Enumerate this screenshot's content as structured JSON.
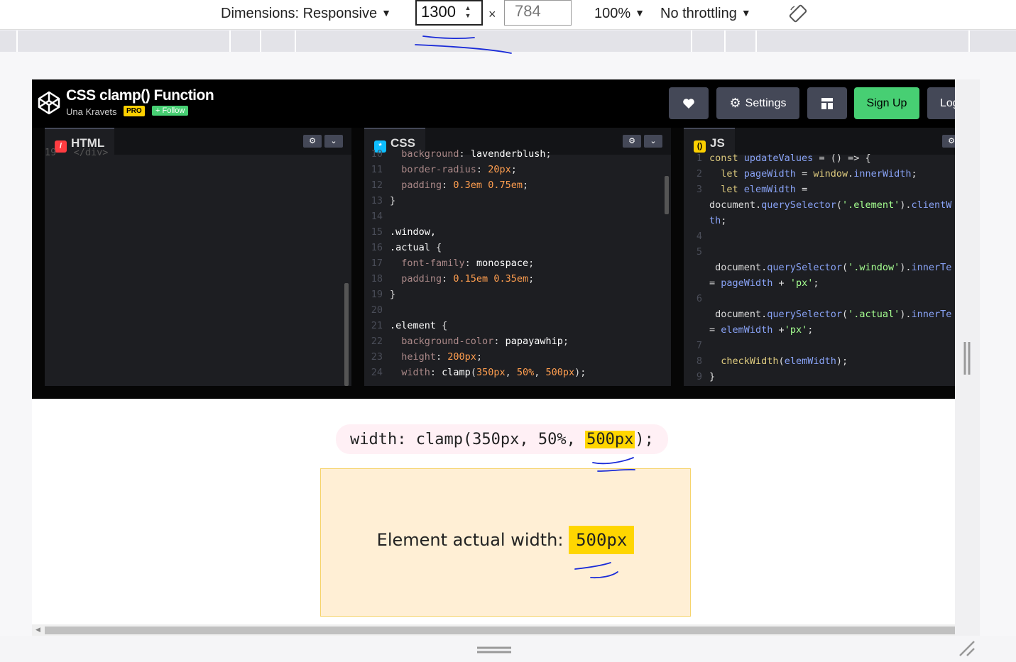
{
  "toolbar": {
    "dimensions_label": "Dimensions: Responsive",
    "width_value": "1300",
    "times": "×",
    "height_placeholder": "784",
    "zoom": "100%",
    "throttling": "No throttling"
  },
  "codepen": {
    "title": "CSS clamp() Function",
    "author": "Una Kravets",
    "pro_badge": "PRO",
    "follow": "+ Follow",
    "settings_label": "Settings",
    "signup_label": "Sign Up",
    "login_label": "Log In",
    "brand_green": "#47cf73"
  },
  "panels": {
    "html": {
      "label": "HTML",
      "visible_fragment": "19   </div>"
    },
    "css": {
      "label": "CSS",
      "lines": [
        {
          "n": "10",
          "parts": [
            [
              "p",
              "  background"
            ],
            [
              "x",
              ": "
            ],
            [
              "v",
              "lavenderblush"
            ],
            [
              "x",
              ";"
            ]
          ]
        },
        {
          "n": "11",
          "parts": [
            [
              "p",
              "  border-radius"
            ],
            [
              "x",
              ": "
            ],
            [
              "u",
              "20px"
            ],
            [
              "x",
              ";"
            ]
          ]
        },
        {
          "n": "12",
          "parts": [
            [
              "p",
              "  padding"
            ],
            [
              "x",
              ": "
            ],
            [
              "u",
              "0.3em 0.75em"
            ],
            [
              "x",
              ";"
            ]
          ]
        },
        {
          "n": "13",
          "parts": [
            [
              "x",
              "}"
            ]
          ]
        },
        {
          "n": "14",
          "parts": []
        },
        {
          "n": "15",
          "parts": [
            [
              "s",
              ".window,"
            ]
          ]
        },
        {
          "n": "16",
          "parts": [
            [
              "s",
              ".actual"
            ],
            [
              "x",
              " {"
            ]
          ]
        },
        {
          "n": "17",
          "parts": [
            [
              "p",
              "  font-family"
            ],
            [
              "x",
              ": "
            ],
            [
              "v",
              "monospace"
            ],
            [
              "x",
              ";"
            ]
          ]
        },
        {
          "n": "18",
          "parts": [
            [
              "p",
              "  padding"
            ],
            [
              "x",
              ": "
            ],
            [
              "u",
              "0.15em 0.35em"
            ],
            [
              "x",
              ";"
            ]
          ]
        },
        {
          "n": "19",
          "parts": [
            [
              "x",
              "}"
            ]
          ]
        },
        {
          "n": "20",
          "parts": []
        },
        {
          "n": "21",
          "parts": [
            [
              "s",
              ".element"
            ],
            [
              "x",
              " {"
            ]
          ]
        },
        {
          "n": "22",
          "parts": [
            [
              "p",
              "  background-color"
            ],
            [
              "x",
              ": "
            ],
            [
              "v",
              "papayawhip"
            ],
            [
              "x",
              ";"
            ]
          ]
        },
        {
          "n": "23",
          "parts": [
            [
              "p",
              "  height"
            ],
            [
              "x",
              ": "
            ],
            [
              "u",
              "200px"
            ],
            [
              "x",
              ";"
            ]
          ]
        },
        {
          "n": "24",
          "parts": [
            [
              "p",
              "  width"
            ],
            [
              "x",
              ": "
            ],
            [
              "v",
              "clamp"
            ],
            [
              "x",
              "("
            ],
            [
              "u",
              "350px"
            ],
            [
              "x",
              ", "
            ],
            [
              "u",
              "50%"
            ],
            [
              "x",
              ", "
            ],
            [
              "u",
              "500px"
            ],
            [
              "x",
              ");"
            ]
          ]
        }
      ]
    },
    "js": {
      "label": "JS",
      "lines": [
        {
          "n": "1",
          "parts": [
            [
              "k",
              "const "
            ],
            [
              "r",
              "updateValues"
            ],
            [
              "x",
              " = () => {"
            ]
          ]
        },
        {
          "n": "2",
          "parts": [
            [
              "k",
              "  let "
            ],
            [
              "r",
              "pageWidth"
            ],
            [
              "x",
              " = "
            ],
            [
              "k",
              "window"
            ],
            [
              "x",
              "."
            ],
            [
              "r",
              "innerWidth"
            ],
            [
              "x",
              ";"
            ]
          ]
        },
        {
          "n": "3",
          "parts": [
            [
              "k",
              "  let "
            ],
            [
              "r",
              "elemWidth"
            ],
            [
              "x",
              " ="
            ]
          ]
        },
        {
          "n": "",
          "parts": [
            [
              "x",
              "document"
            ],
            [
              "x",
              "."
            ],
            [
              "r",
              "querySelector"
            ],
            [
              "x",
              "("
            ],
            [
              "g",
              "'.element'"
            ],
            [
              "x",
              ")."
            ],
            [
              "r",
              "clientW"
            ]
          ]
        },
        {
          "n": "",
          "parts": [
            [
              "r",
              "th"
            ],
            [
              "x",
              ";"
            ]
          ]
        },
        {
          "n": "4",
          "parts": []
        },
        {
          "n": "5",
          "parts": []
        },
        {
          "n": "",
          "parts": [
            [
              "x",
              " document"
            ],
            [
              "x",
              "."
            ],
            [
              "r",
              "querySelector"
            ],
            [
              "x",
              "("
            ],
            [
              "g",
              "'.window'"
            ],
            [
              "x",
              ")."
            ],
            [
              "r",
              "innerTe"
            ]
          ]
        },
        {
          "n": "",
          "parts": [
            [
              "x",
              "= "
            ],
            [
              "r",
              "pageWidth"
            ],
            [
              "x",
              " + "
            ],
            [
              "g",
              "'px'"
            ],
            [
              "x",
              ";"
            ]
          ]
        },
        {
          "n": "6",
          "parts": []
        },
        {
          "n": "",
          "parts": [
            [
              "x",
              " document"
            ],
            [
              "x",
              "."
            ],
            [
              "r",
              "querySelector"
            ],
            [
              "x",
              "("
            ],
            [
              "g",
              "'.actual'"
            ],
            [
              "x",
              ")."
            ],
            [
              "r",
              "innerTe"
            ]
          ]
        },
        {
          "n": "",
          "parts": [
            [
              "x",
              "= "
            ],
            [
              "r",
              "elemWidth"
            ],
            [
              "x",
              " +"
            ],
            [
              "g",
              "'px'"
            ],
            [
              "x",
              ";"
            ]
          ]
        },
        {
          "n": "7",
          "parts": []
        },
        {
          "n": "8",
          "parts": [
            [
              "k",
              "  checkWidth"
            ],
            [
              "x",
              "("
            ],
            [
              "r",
              "elemWidth"
            ],
            [
              "x",
              ");"
            ]
          ]
        },
        {
          "n": "9",
          "parts": [
            [
              "x",
              "}"
            ]
          ]
        }
      ]
    }
  },
  "demo": {
    "window_prefix": "width: clamp(350px, 50%, ",
    "window_value": "500px",
    "window_suffix": ");",
    "actual_label": "Element actual width: ",
    "actual_value": "500px"
  }
}
